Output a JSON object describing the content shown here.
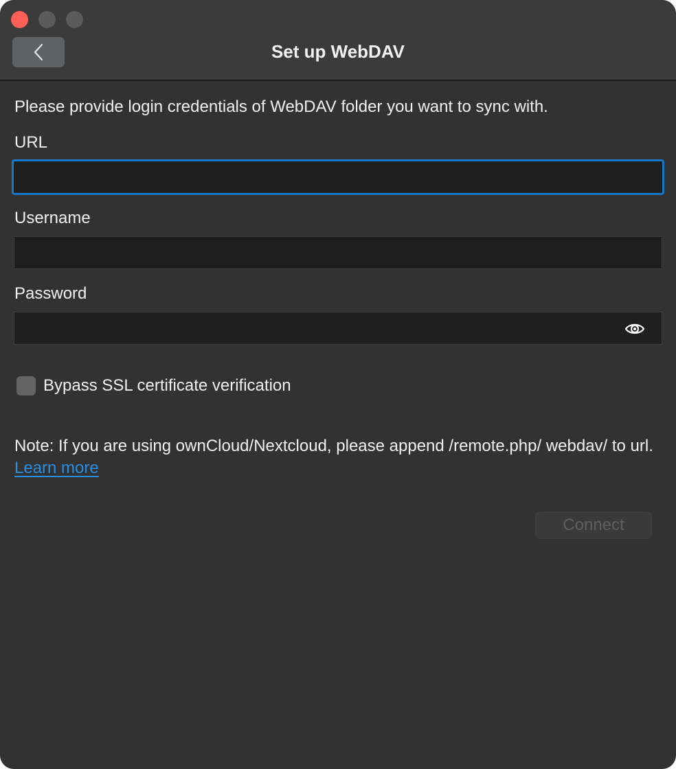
{
  "window": {
    "title": "Set up WebDAV"
  },
  "intro_text": "Please provide login credentials of WebDAV folder you want to sync with.",
  "form": {
    "url": {
      "label": "URL",
      "value": "",
      "placeholder": ""
    },
    "username": {
      "label": "Username",
      "value": "",
      "placeholder": ""
    },
    "password": {
      "label": "Password",
      "value": "",
      "placeholder": ""
    }
  },
  "ssl_bypass": {
    "label": "Bypass SSL certificate verification",
    "checked": false
  },
  "note": {
    "text": "Note: If you are using ownCloud/Nextcloud, please append /remote.php/ webdav/ to url. ",
    "link_label": "Learn more"
  },
  "connect_label": "Connect",
  "icons": {
    "back": "chevron-left-icon",
    "reveal_password": "eye-icon"
  },
  "colors": {
    "accent": "#1779c9",
    "link": "#2a8ee0",
    "close": "#fe5f57"
  }
}
